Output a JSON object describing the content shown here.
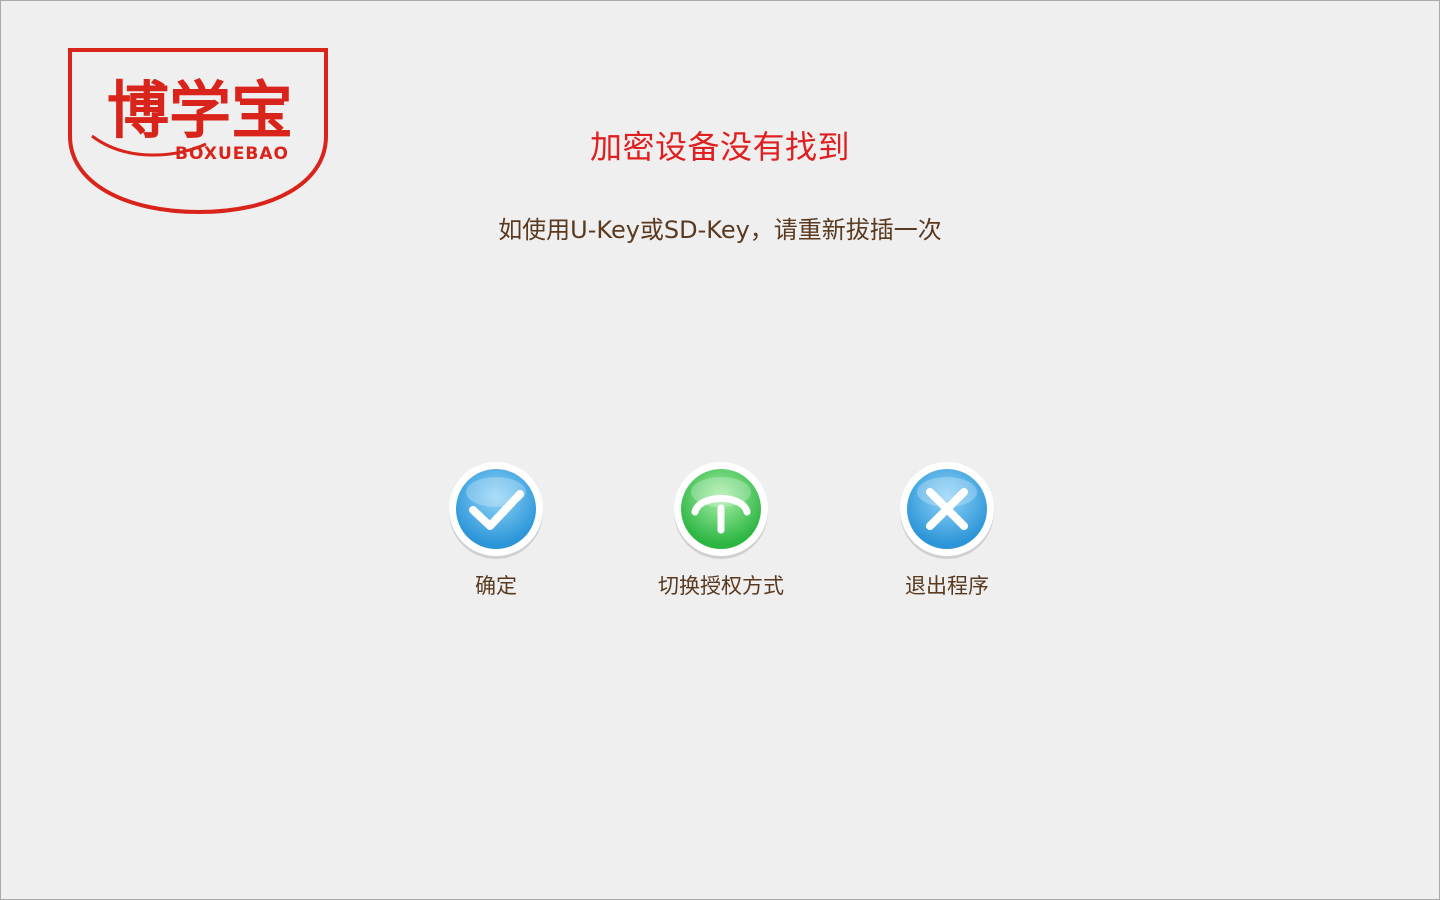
{
  "brand": {
    "logo_cn": "博学宝",
    "logo_en": "BOXUEBAO",
    "color": "#d9241c"
  },
  "message": {
    "title": "加密设备没有找到",
    "subtitle": "如使用U-Key或SD-Key，请重新拔插一次",
    "title_color": "#e02020",
    "text_color": "#5a3a1f"
  },
  "actions": [
    {
      "label": "确定",
      "icon": "checkmark-icon",
      "color": "#43a6e4"
    },
    {
      "label": "切换授权方式",
      "icon": "switch-icon",
      "color": "#3cc251"
    },
    {
      "label": "退出程序",
      "icon": "close-icon",
      "color": "#43a6e4"
    }
  ]
}
